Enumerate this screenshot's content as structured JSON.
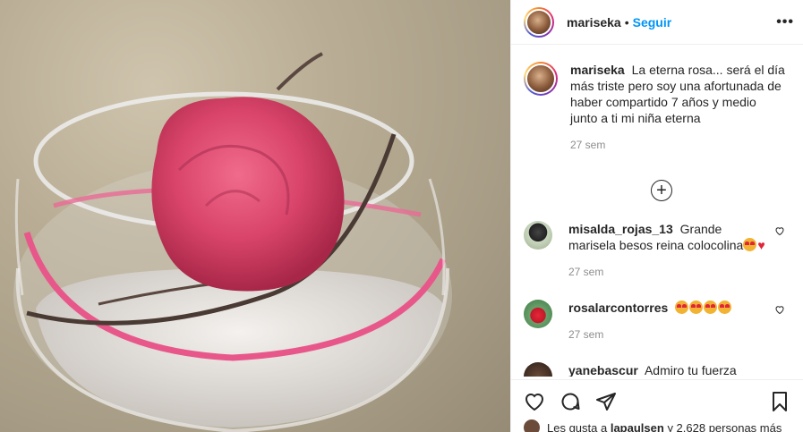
{
  "post": {
    "username": "mariseka",
    "separator": "•",
    "follow_label": "Seguir",
    "more_label": "•••"
  },
  "caption": {
    "username": "mariseka",
    "text": "La eterna rosa... será el día más triste pero soy una afortunada de haber compartido 7 años y medio junto a ti mi niña eterna",
    "time": "27 sem"
  },
  "load_more_label": "+",
  "comments": [
    {
      "username": "misalda_rojas_13",
      "text": "Grande marisela besos reina colocolina",
      "emoji_count": 1,
      "extra": "♥",
      "time": "27 sem"
    },
    {
      "username": "rosalarcontorres",
      "text": "",
      "emoji_count": 4,
      "extra": "",
      "time": "27 sem"
    },
    {
      "username": "yanebascur",
      "text": "Admiro tu fuerza",
      "time": ""
    }
  ],
  "likes": {
    "prefix": "Les gusta a",
    "user": "lapaulsen",
    "suffix": "y 2.628 personas más"
  },
  "icons": [
    "heart-outline-icon",
    "comment-icon",
    "share-icon",
    "bookmark-icon"
  ],
  "colors": {
    "accent": "#0095f6",
    "muted": "#8e8e8e",
    "ribbon": "#e8578a"
  }
}
